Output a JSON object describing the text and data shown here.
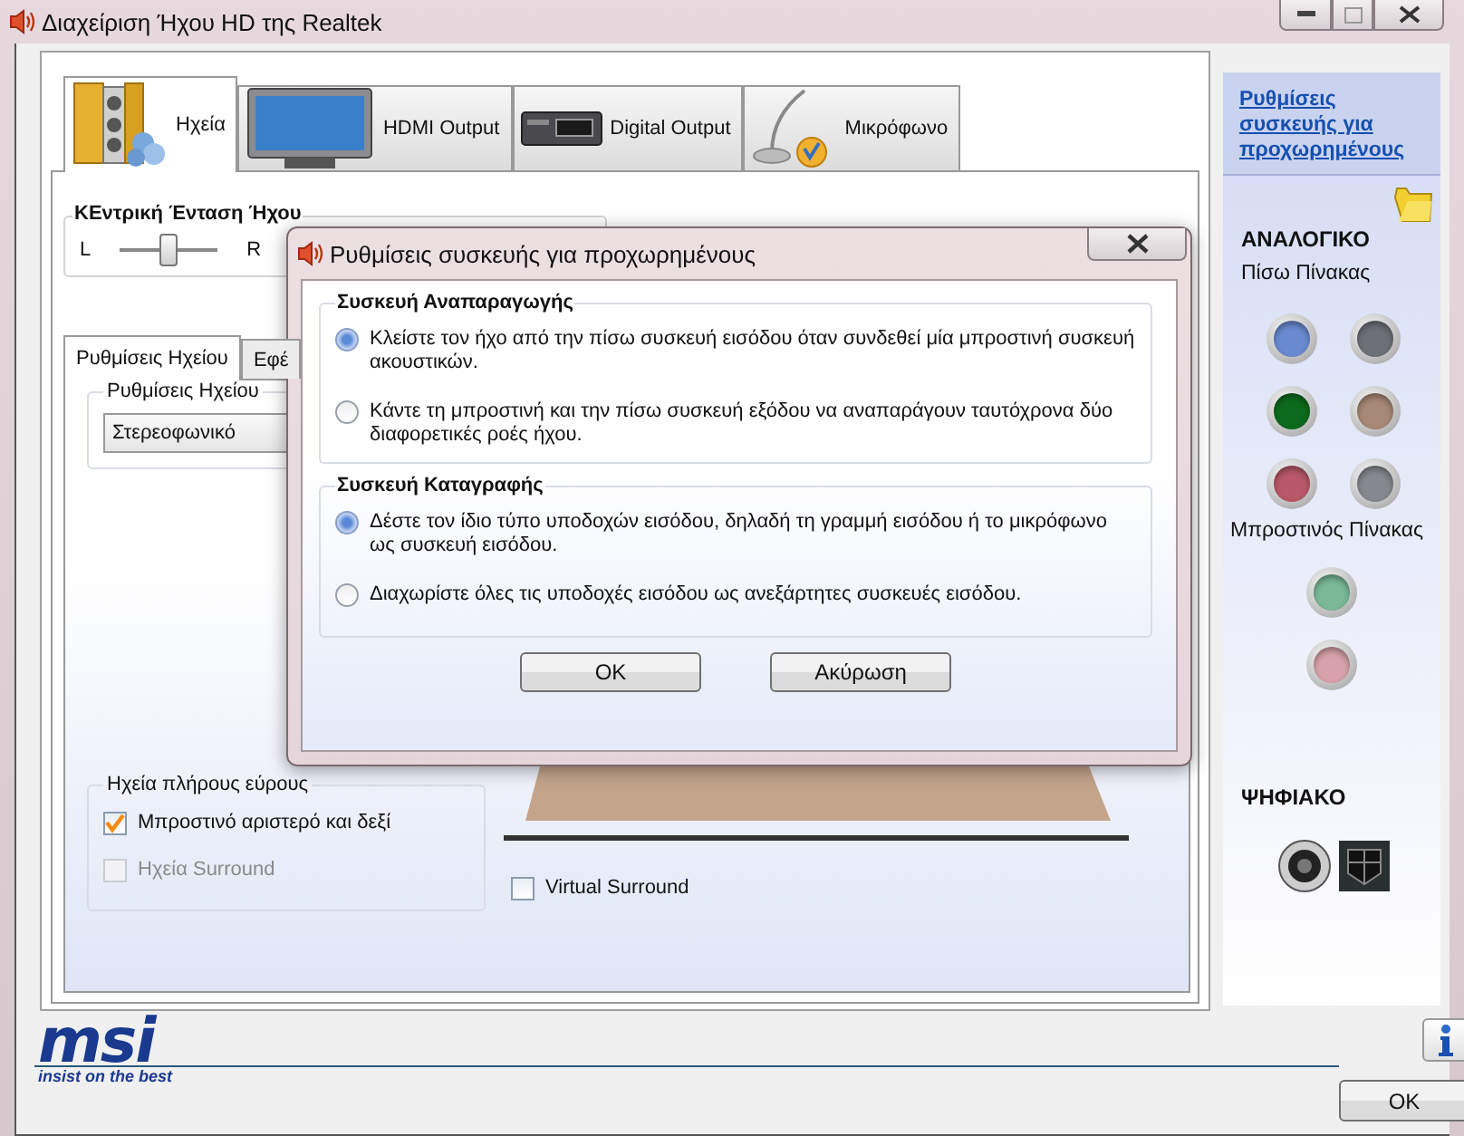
{
  "window": {
    "title": "Διαχείριση Ήχου HD της Realtek"
  },
  "tabs": [
    {
      "label": "Ηχεία",
      "selected": true,
      "kind": "speakers"
    },
    {
      "label": "HDMI Output",
      "selected": false,
      "kind": "monitor"
    },
    {
      "label": "Digital Output",
      "selected": false,
      "kind": "receiver"
    },
    {
      "label": "Μικρόφωνο",
      "selected": false,
      "kind": "microphone"
    }
  ],
  "master_volume": {
    "title": "ΚΕντρική Ένταση Ήχου",
    "left_label": "L",
    "right_label": "R",
    "level": 0.5
  },
  "sub_tabs": [
    {
      "label": "Ρυθμίσεις Ηχείου",
      "selected": true
    },
    {
      "label": "Εφέ",
      "selected": false
    }
  ],
  "speaker_settings": {
    "title": "Ρυθμίσεις Ηχείου",
    "value": "Στερεοφωνικό"
  },
  "full_range": {
    "title": "Ηχεία πλήρους εύρους",
    "options": [
      {
        "label": "Μπροστινό αριστερό και δεξί",
        "checked": true,
        "disabled": false
      },
      {
        "label": "Ηχεία Surround",
        "checked": false,
        "disabled": true
      }
    ]
  },
  "virtual_surround": {
    "label": "Virtual Surround",
    "checked": false
  },
  "side_panel": {
    "link": "Ρυθμίσεις συσκευής για προχωρημένους",
    "analog_title": "ΑΝΑΛΟΓΙΚΟ",
    "rear_title": "Πίσω Πίνακας",
    "rear_jacks": [
      {
        "color": "#6a8ad0"
      },
      {
        "color": "#6e7078"
      },
      {
        "color": "#0c6a1c"
      },
      {
        "color": "#a88876"
      },
      {
        "color": "#b85868"
      },
      {
        "color": "#85888e"
      }
    ],
    "front_title": "Μπροστινός Πίνακας",
    "front_jacks": [
      {
        "color": "#7ab898"
      },
      {
        "color": "#d8a2aa"
      }
    ],
    "digital_title": "ΨΗΦΙΑΚΟ"
  },
  "logo": {
    "brand": "msi",
    "tagline": "insist on the best"
  },
  "ok_button": "OK",
  "dialog": {
    "title": "Ρυθμίσεις συσκευής για προχωρημένους",
    "groups": [
      {
        "title": "Συσκευή Αναπαραγωγής",
        "options": [
          {
            "label": "Κλείστε τον ήχο από την πίσω συσκευή εισόδου όταν συνδεθεί μία μπροστινή συσκευή ακουστικών.",
            "selected": true
          },
          {
            "label": "Κάντε τη μπροστινή και την πίσω συσκευή εξόδου να αναπαράγουν ταυτόχρονα δύο διαφορετικές ροές ήχου.",
            "selected": false
          }
        ]
      },
      {
        "title": "Συσκευή Καταγραφής",
        "options": [
          {
            "label": "Δέστε τον ίδιο τύπο υποδοχών εισόδου, δηλαδή τη γραμμή εισόδου ή το μικρόφωνο ως συσκευή εισόδου.",
            "selected": true
          },
          {
            "label": "Διαχωρίστε όλες τις υποδοχές εισόδου ως ανεξάρτητες συσκευές εισόδου.",
            "selected": false
          }
        ]
      }
    ],
    "buttons": [
      "OK",
      "Ακύρωση"
    ]
  }
}
